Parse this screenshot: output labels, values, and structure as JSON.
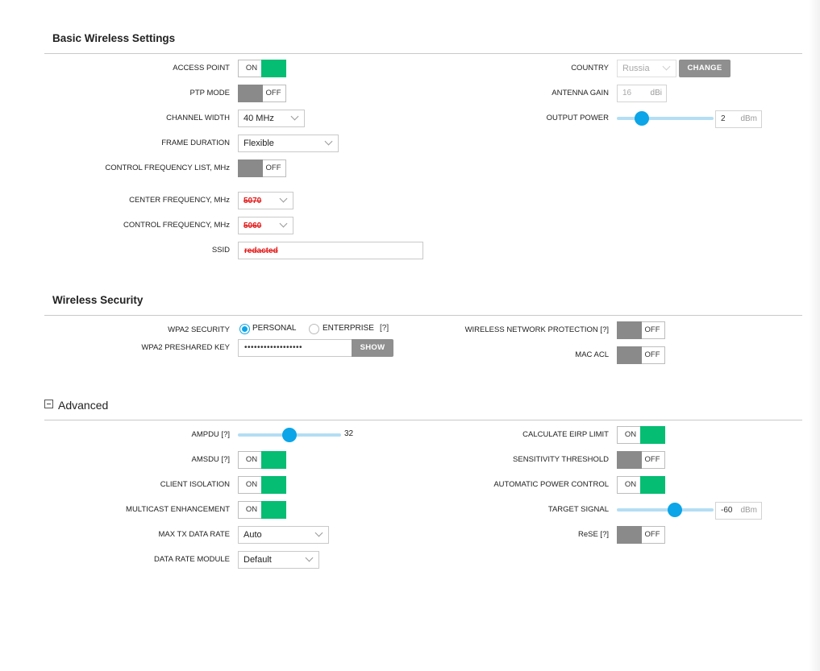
{
  "basic": {
    "title": "Basic Wireless Settings",
    "access_point": {
      "label": "ACCESS POINT",
      "state": "ON"
    },
    "ptp_mode": {
      "label": "PTP MODE",
      "state": "OFF"
    },
    "channel_width": {
      "label": "CHANNEL WIDTH",
      "value": "40 MHz"
    },
    "frame_duration": {
      "label": "FRAME DURATION",
      "value": "Flexible"
    },
    "control_freq_list": {
      "label": "CONTROL FREQUENCY LIST, MHz",
      "state": "OFF"
    },
    "center_frequency": {
      "label": "CENTER FREQUENCY, MHz",
      "value": "5070"
    },
    "control_frequency": {
      "label": "CONTROL FREQUENCY, MHz",
      "value": "5060"
    },
    "ssid": {
      "label": "SSID",
      "value": "redacted"
    },
    "country": {
      "label": "COUNTRY",
      "value": "Russia",
      "button": "CHANGE"
    },
    "antenna_gain": {
      "label": "ANTENNA GAIN",
      "value": "16",
      "unit": "dBi"
    },
    "output_power": {
      "label": "OUTPUT POWER",
      "value": "2",
      "unit": "dBm",
      "level_fraction": 0.26
    }
  },
  "security": {
    "title": "Wireless Security",
    "wpa2": {
      "label": "WPA2 SECURITY",
      "options": [
        "PERSONAL",
        "ENTERPRISE"
      ],
      "selected": "PERSONAL",
      "help": "[?]"
    },
    "psk": {
      "label": "WPA2 PRESHARED KEY",
      "value": "••••••••••••••••••",
      "button": "SHOW"
    },
    "wnp": {
      "label": "WIRELESS NETWORK PROTECTION [?]",
      "state": "OFF"
    },
    "mac_acl": {
      "label": "MAC ACL",
      "state": "OFF"
    }
  },
  "advanced": {
    "title": "Advanced",
    "ampdu": {
      "label": "AMPDU [?]",
      "value": "32",
      "level_fraction": 0.5
    },
    "amsdu": {
      "label": "AMSDU [?]",
      "state": "ON"
    },
    "client_isolation": {
      "label": "CLIENT ISOLATION",
      "state": "ON"
    },
    "multicast": {
      "label": "MULTICAST ENHANCEMENT",
      "state": "ON"
    },
    "max_tx": {
      "label": "MAX TX DATA RATE",
      "value": "Auto"
    },
    "data_rate_module": {
      "label": "DATA RATE MODULE",
      "value": "Default"
    },
    "eirp": {
      "label": "CALCULATE EIRP LIMIT",
      "state": "ON"
    },
    "sensitivity": {
      "label": "SENSITIVITY THRESHOLD",
      "state": "OFF"
    },
    "apc": {
      "label": "AUTOMATIC POWER CONTROL",
      "state": "ON"
    },
    "target_signal": {
      "label": "TARGET SIGNAL",
      "value": "-60",
      "unit": "dBm",
      "level_fraction": 0.6
    },
    "rese": {
      "label": "ReSE [?]",
      "state": "OFF"
    }
  },
  "colors": {
    "on": "#05bd73",
    "off": "#8a8a8a",
    "slider": "#0ba5e8",
    "track": "#b4def4"
  }
}
